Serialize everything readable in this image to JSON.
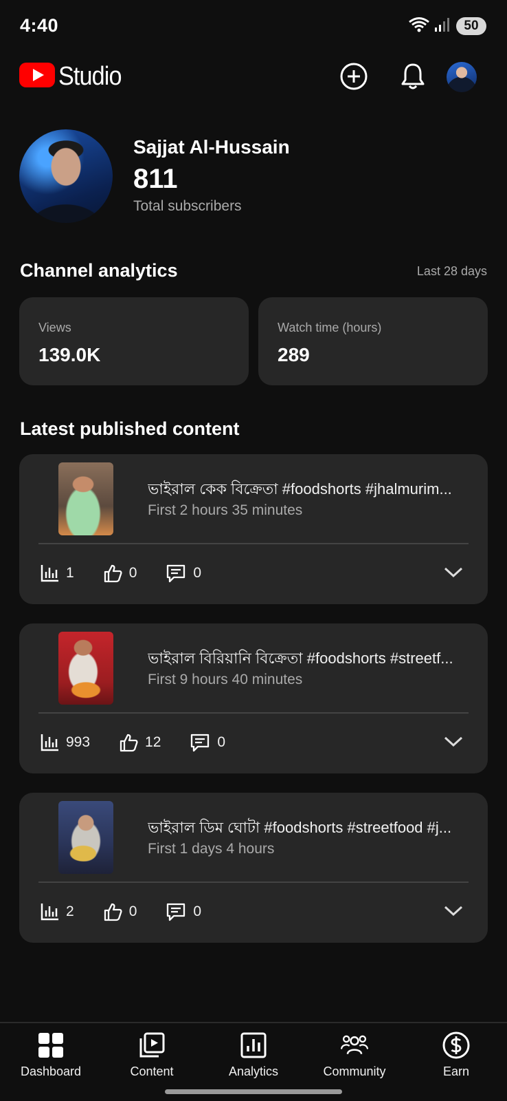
{
  "status_bar": {
    "time": "4:40",
    "battery": "50"
  },
  "header": {
    "logo_text": "Studio"
  },
  "profile": {
    "name": "Sajjat Al-Hussain",
    "subscribers": "811",
    "subscribers_label": "Total subscribers"
  },
  "analytics": {
    "title": "Channel analytics",
    "period": "Last 28 days",
    "views_label": "Views",
    "views_value": "139.0K",
    "watch_label": "Watch time (hours)",
    "watch_value": "289"
  },
  "latest": {
    "title": "Latest published content",
    "items": [
      {
        "title": "ভাইরাল কেক বিক্রেতা #foodshorts #jhalmurim...",
        "age": "First 2 hours 35 minutes",
        "views": "1",
        "likes": "0",
        "comments": "0"
      },
      {
        "title": "ভাইরাল বিরিয়ানি বিক্রেতা #foodshorts #streetf...",
        "age": "First 9 hours 40 minutes",
        "views": "993",
        "likes": "12",
        "comments": "0"
      },
      {
        "title": "ভাইরাল ডিম ঘোটা #foodshorts #streetfood #j...",
        "age": "First 1 days 4 hours",
        "views": "2",
        "likes": "0",
        "comments": "0"
      }
    ]
  },
  "nav": {
    "dashboard": "Dashboard",
    "content": "Content",
    "analytics": "Analytics",
    "community": "Community",
    "earn": "Earn"
  },
  "colors": {
    "background": "#0f0f0f",
    "card": "#272727",
    "brand_red": "#ff0000",
    "secondary_text": "#aaaaaa"
  }
}
